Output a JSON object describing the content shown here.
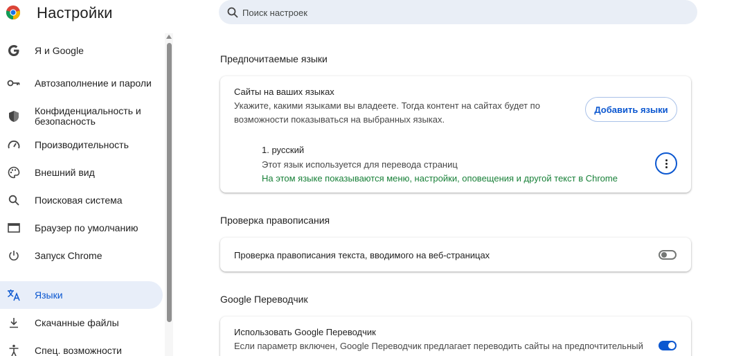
{
  "app": {
    "title": "Настройки"
  },
  "search": {
    "placeholder": "Поиск настроек"
  },
  "sidebar": {
    "items": [
      {
        "label": "Я и Google",
        "icon": "google-icon"
      },
      {
        "label": "Автозаполнение и пароли",
        "icon": "key-icon"
      },
      {
        "label": "Конфиденциальность и безопасность",
        "icon": "shield-icon"
      },
      {
        "label": "Производительность",
        "icon": "speedometer-icon"
      },
      {
        "label": "Внешний вид",
        "icon": "palette-icon"
      },
      {
        "label": "Поисковая система",
        "icon": "search-icon"
      },
      {
        "label": "Браузер по умолчанию",
        "icon": "browser-window-icon"
      },
      {
        "label": "Запуск Chrome",
        "icon": "power-icon"
      },
      {
        "label": "Языки",
        "icon": "translate-icon",
        "active": true
      },
      {
        "label": "Скачанные файлы",
        "icon": "download-icon"
      },
      {
        "label": "Спец. возможности",
        "icon": "accessibility-icon"
      }
    ]
  },
  "languages": {
    "section_title": "Предпочитаемые языки",
    "card_title": "Сайты на ваших языках",
    "card_desc_line1": "Укажите, какими языками вы владеете. Тогда контент на сайтах будет по",
    "card_desc_line2": "возможности показываться на выбранных языках.",
    "add_button": "Добавить языки",
    "items": [
      {
        "name": "1. русский",
        "note": "Этот язык используется для перевода страниц",
        "ui_note": "На этом языке показываются меню, настройки, оповещения и другой текст в Chrome"
      }
    ]
  },
  "spellcheck": {
    "section_title": "Проверка правописания",
    "label": "Проверка правописания текста, вводимого на веб-страницах",
    "enabled": false
  },
  "translate": {
    "section_title": "Google Переводчик",
    "label": "Использовать Google Переводчик",
    "desc": "Если параметр включен, Google Переводчик предлагает переводить сайты на предпочтительный",
    "enabled": true
  },
  "colors": {
    "accent": "#0b57d0",
    "active_bg": "#e8eef9",
    "green": "#188038"
  }
}
